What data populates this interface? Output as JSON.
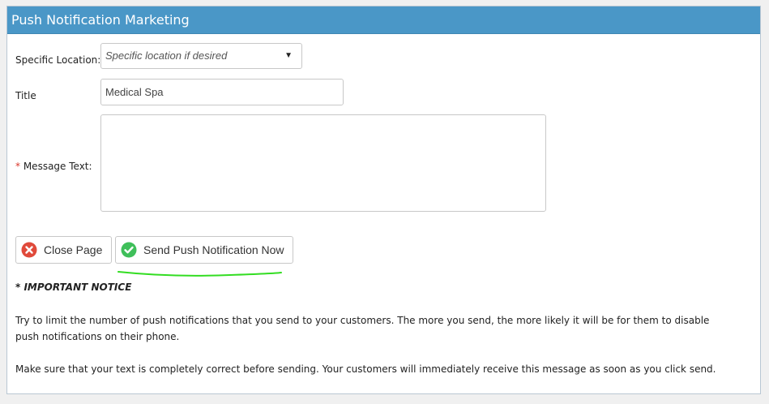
{
  "panel": {
    "title": "Push Notification Marketing"
  },
  "form": {
    "location_label": "Specific Location:",
    "location_placeholder": "Specific location if desired",
    "title_label": "Title",
    "title_value": "Medical Spa",
    "message_required_mark": "*",
    "message_label": "Message Text:",
    "message_value": ""
  },
  "buttons": {
    "close_label": "Close Page",
    "send_label": "Send Push Notification Now"
  },
  "notice": {
    "heading": "* IMPORTANT NOTICE",
    "paragraph1": "Try to limit the number of push notifications that you send to your customers. The more you send, the more likely it will be for them to disable push notifications on their phone.",
    "paragraph2": "Make sure that your text is completely correct before sending. Your customers will immediately receive this message as soon as you click send."
  },
  "icons": {
    "close": "close-circle-icon",
    "send": "check-circle-icon",
    "dropdown": "caret-down-icon"
  },
  "colors": {
    "header": "#4a97c7",
    "close_icon": "#e04a3b",
    "send_icon": "#3fbf5a",
    "annotation": "#33dd22"
  }
}
